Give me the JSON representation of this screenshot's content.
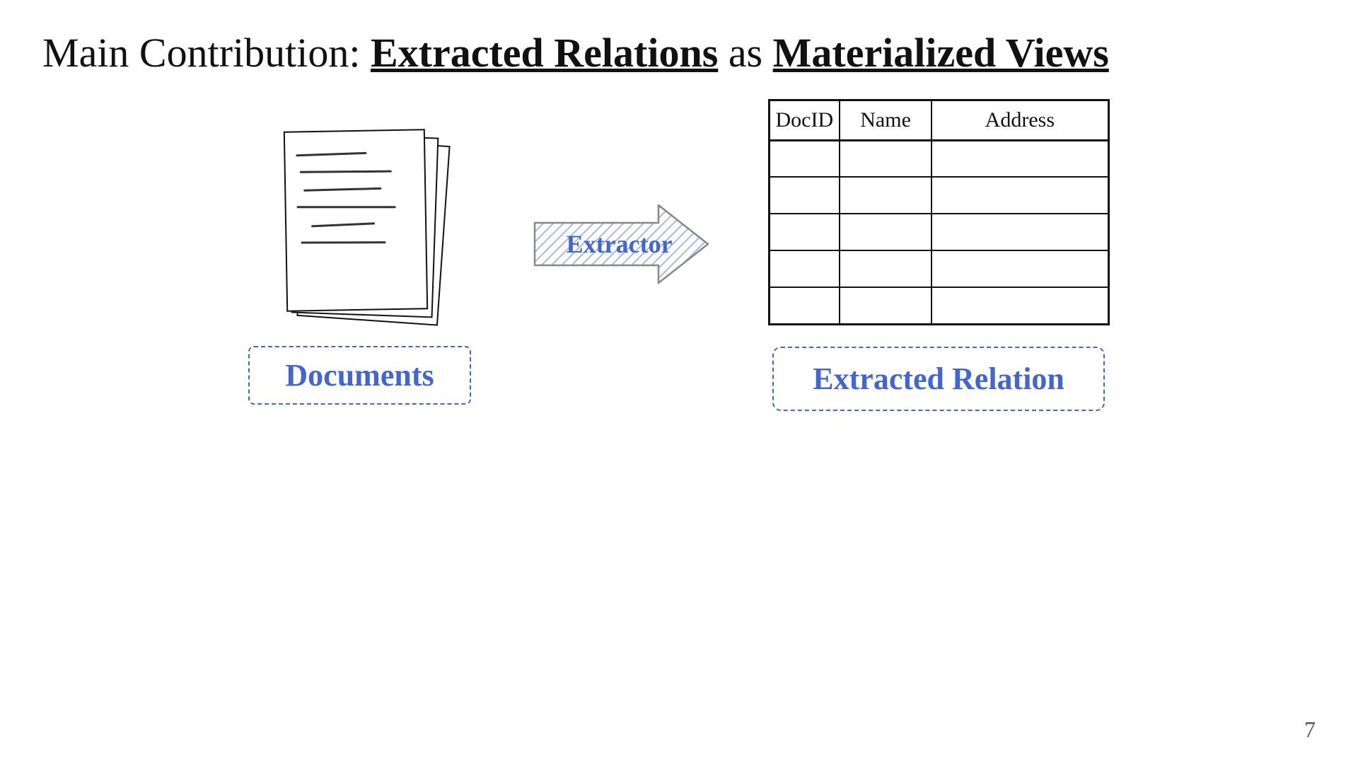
{
  "title": {
    "prefix": "Main Contribution: ",
    "term1": "Extracted Relations",
    "middle": " as ",
    "term2": "Materialized Views"
  },
  "documents_label": "Documents",
  "extractor_label": "Extractor",
  "table": {
    "headers": [
      "DocID",
      "Name",
      "Address"
    ],
    "rows": 5
  },
  "extracted_relation_label": "Extracted Relation",
  "page_number": "7"
}
